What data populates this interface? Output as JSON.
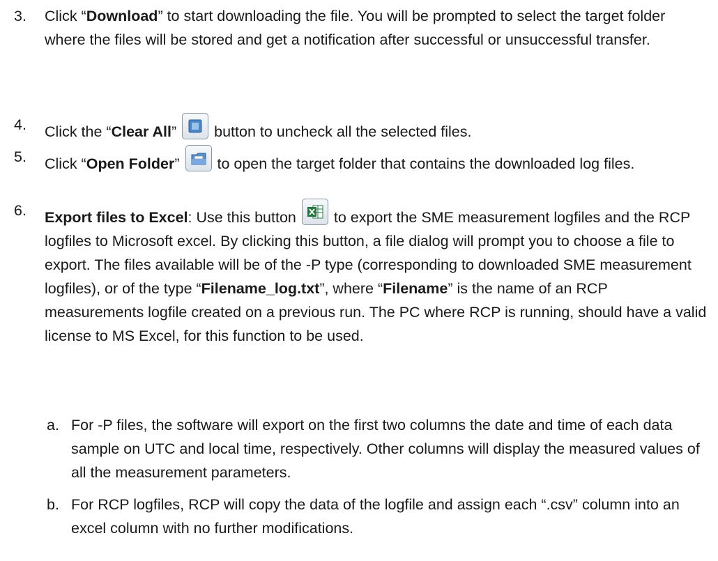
{
  "colors": {
    "text": "#1a1a1a",
    "icon_border": "#8a97a6",
    "excel_green": "#1e7a3c"
  },
  "items": {
    "i3": {
      "number": "3.",
      "pre": "Click “",
      "bold": "Download",
      "post": "” to start downloading the file. You will be prompted to select the target folder where the files will be stored and get a notification after successful or unsuccessful transfer."
    },
    "i4": {
      "number": "4.",
      "pre": "Click the “",
      "bold": "Clear All",
      "mid": "”",
      "icon": "clear-all-icon",
      "post": " button to uncheck all the selected files."
    },
    "i5": {
      "number": "5.",
      "pre": "Click “",
      "bold": "Open Folder",
      "mid": "”",
      "icon": "open-folder-icon",
      "post": " to open the target folder that contains the downloaded log files."
    },
    "i6": {
      "number": "6.",
      "bold": "Export files to Excel",
      "pre": ": Use this button",
      "icon": "excel-export-icon",
      "post1": " to export the SME measurement logfiles and the RCP logfiles to Microsoft excel. By clicking this button, a file dialog will prompt you to choose a file to export. The files available will be of the -P type (corresponding to downloaded SME measurement logfiles), or of the type “",
      "bold2": "Filename_log.txt",
      "post2": "”, where “",
      "bold3": "Filename",
      "post3": "” is the name of an RCP measurements logfile created on a previous run. The PC where RCP is running, should have a valid license to MS Excel, for this function to be used."
    },
    "sub_a": {
      "letter": "a.",
      "text": "For -P files, the software will export on the first two columns the date and time of each data sample on UTC and local time, respectively. Other columns will display the measured values of all the measurement parameters."
    },
    "sub_b": {
      "letter": "b.",
      "text": "For RCP logfiles, RCP will copy the data of the logfile and assign each “.csv” column into an excel column with no further modifications."
    }
  }
}
